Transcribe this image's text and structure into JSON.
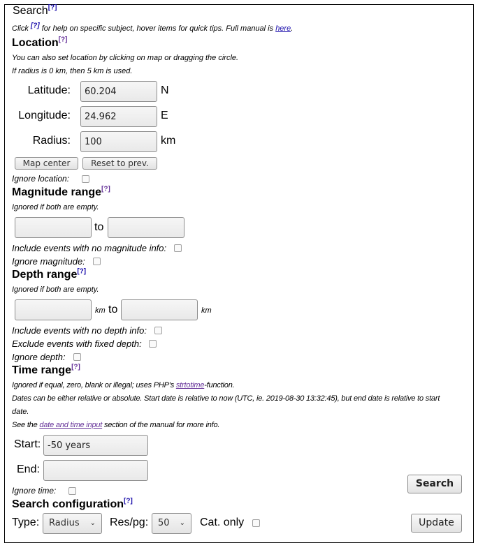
{
  "fieldset": {
    "legend": "Search",
    "help_marker": "[?]",
    "intro": {
      "click": "Click",
      "rest": "for help on specific subject, hover items for quick tips. Full manual is",
      "link": "here",
      "end": "."
    }
  },
  "location": {
    "heading": "Location",
    "note1": "You can also set location by clicking on map or dragging the circle.",
    "note2": "If radius is 0 km, then 5 km is used.",
    "latitude": {
      "label": "Latitude:",
      "value": "60.204",
      "unit": "N"
    },
    "longitude": {
      "label": "Longitude:",
      "value": "24.962",
      "unit": "E"
    },
    "radius": {
      "label": "Radius:",
      "value": "100",
      "unit": "km"
    },
    "map_center_button": "Map center",
    "reset_button": "Reset to prev.",
    "ignore_label": "Ignore location:",
    "ignore_checked": false
  },
  "magnitude": {
    "heading": "Magnitude range",
    "note": "Ignored if both are empty.",
    "min_value": "",
    "max_value": "",
    "to": "to",
    "include_no_info_label": "Include events with no magnitude info:",
    "ignore_label": "Ignore magnitude:"
  },
  "depth": {
    "heading": "Depth range",
    "note": "Ignored if both are empty.",
    "min_value": "",
    "max_value": "",
    "unit": "km",
    "to": "to",
    "include_no_info_label": "Include events with no depth info:",
    "exclude_fixed_label": "Exclude events with fixed depth:",
    "ignore_label": "Ignore depth:"
  },
  "time": {
    "heading": "Time range",
    "note1_pre": "Ignored if equal, zero, blank or illegal; uses PHP's",
    "note1_link": "strtotime",
    "note1_post": "-function.",
    "note2": "Dates can be either relative or absolute. Start date is relative to now (UTC, ie. 2019-08-30 13:32:45), but end date is relative to start",
    "note2b": "date.",
    "note3_pre": "See the",
    "note3_link": "date and time input",
    "note3_post": "section of the manual for more info.",
    "start_label": "Start:",
    "start_value": "-50 years",
    "end_label": "End:",
    "end_value": "",
    "ignore_label": "Ignore time:",
    "search_button": "Search"
  },
  "config": {
    "heading": "Search configuration",
    "type_label": "Type:",
    "type_value": "Radius",
    "respg_label": "Res/pg:",
    "respg_value": "50",
    "catonly_label": "Cat. only",
    "update_button": "Update",
    "chevron": "⌵"
  }
}
